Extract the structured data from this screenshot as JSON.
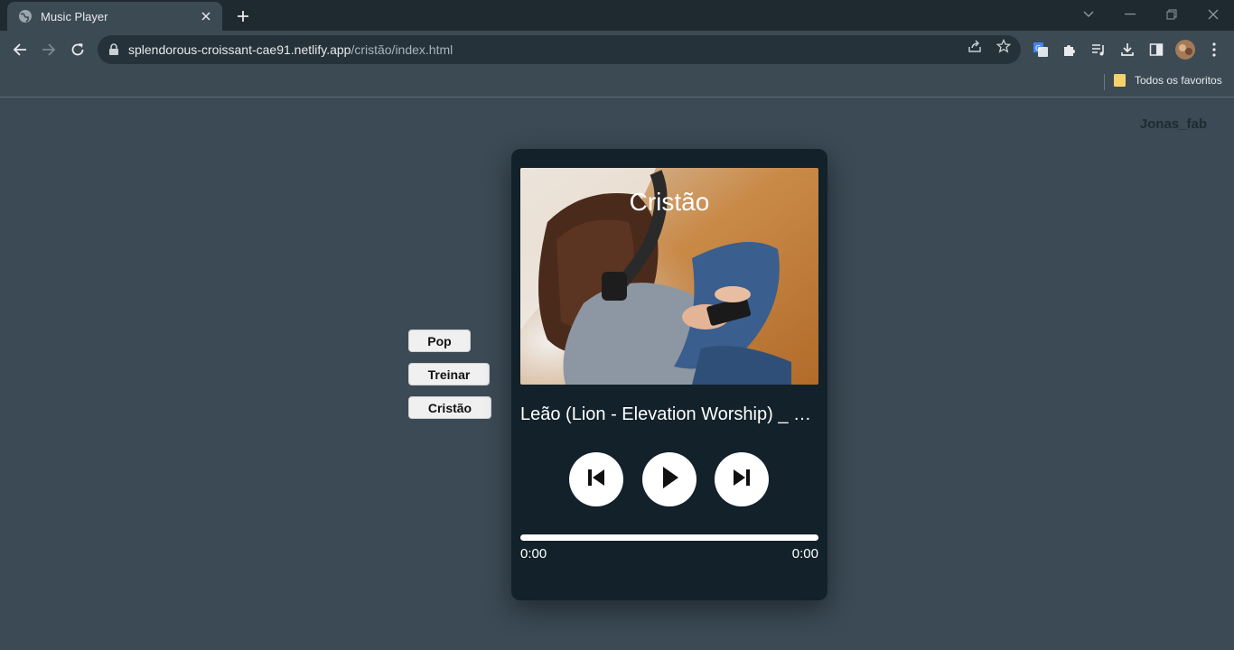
{
  "browser": {
    "tab_title": "Music Player",
    "url_host": "splendorous-croissant-cae91.netlify.app",
    "url_path": "/cristão/index.html",
    "bookmarks_folder": "Todos os favoritos"
  },
  "page": {
    "username": "Jonas_fab",
    "playlists": [
      {
        "label": "Pop"
      },
      {
        "label": "Treinar"
      },
      {
        "label": "Cristão"
      }
    ]
  },
  "player": {
    "cover_title": "Cristão",
    "track_title": "Leão (Lion - Elevation Worship) _ Elevation Worship",
    "current_time": "0:00",
    "duration": "0:00",
    "progress": 0
  },
  "icons": {
    "favicon": "globe-icon",
    "prev": "skip-previous-icon",
    "play": "play-icon",
    "next": "skip-next-icon"
  },
  "colors": {
    "page_bg": "#3b4a55",
    "player_bg": "#12212a",
    "button_bg": "#ffffff"
  }
}
